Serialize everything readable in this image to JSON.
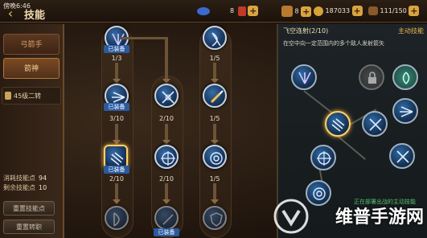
{
  "status": {
    "time": "傍晚6:46"
  },
  "header": {
    "title": "技能"
  },
  "topbar": {
    "energy": "8",
    "stamina": "8",
    "gold": "187033",
    "bag": "111/150"
  },
  "sidebar": {
    "tabs": [
      {
        "label": "弓箭手"
      },
      {
        "label": "箭神"
      }
    ],
    "lock_label": "45级二转",
    "stats": [
      {
        "label": "消耗技能点",
        "value": "94"
      },
      {
        "label": "剩余技能点",
        "value": "10"
      }
    ],
    "buttons": [
      {
        "label": "重置技能点"
      },
      {
        "label": "重置转职"
      }
    ]
  },
  "tree": {
    "equipped_label": "已装备",
    "columns": [
      {
        "nodes": [
          {
            "level": "1/3",
            "equipped": true,
            "icon": "triple-arrow-icon"
          },
          {
            "level": "3/10",
            "equipped": true,
            "icon": "spread-arrow-icon"
          },
          {
            "level": "2/10",
            "equipped": true,
            "icon": "rain-arrow-icon",
            "selected": true
          },
          {
            "level": "",
            "equipped": false,
            "icon": "bow-icon"
          }
        ]
      },
      {
        "nodes": [
          {
            "level": "2/10",
            "equipped": false,
            "icon": "cross-arrow-icon"
          },
          {
            "level": "2/10",
            "equipped": false,
            "icon": "compass-icon"
          },
          {
            "level": "",
            "equipped": true,
            "icon": "feather-icon"
          }
        ]
      },
      {
        "nodes": [
          {
            "level": "1/5",
            "equipped": false,
            "icon": "bow-icon"
          },
          {
            "level": "1/5",
            "equipped": false,
            "icon": "dagger-icon"
          },
          {
            "level": "1/5",
            "equipped": false,
            "icon": "target-icon"
          },
          {
            "level": "",
            "equipped": false,
            "icon": "shield-icon"
          }
        ]
      }
    ]
  },
  "detail": {
    "title": "飞空连射(2/10)",
    "type": "主动技能",
    "description": "在空中向一定范围内的多个敌人发射箭矢",
    "footer": "正在部署出战的主动技能"
  },
  "watermark": "维普手游网",
  "colors": {
    "accent": "#e6b84e",
    "equipped_tag": "#2a5aa0",
    "node_blue": "#2f6aa3"
  }
}
